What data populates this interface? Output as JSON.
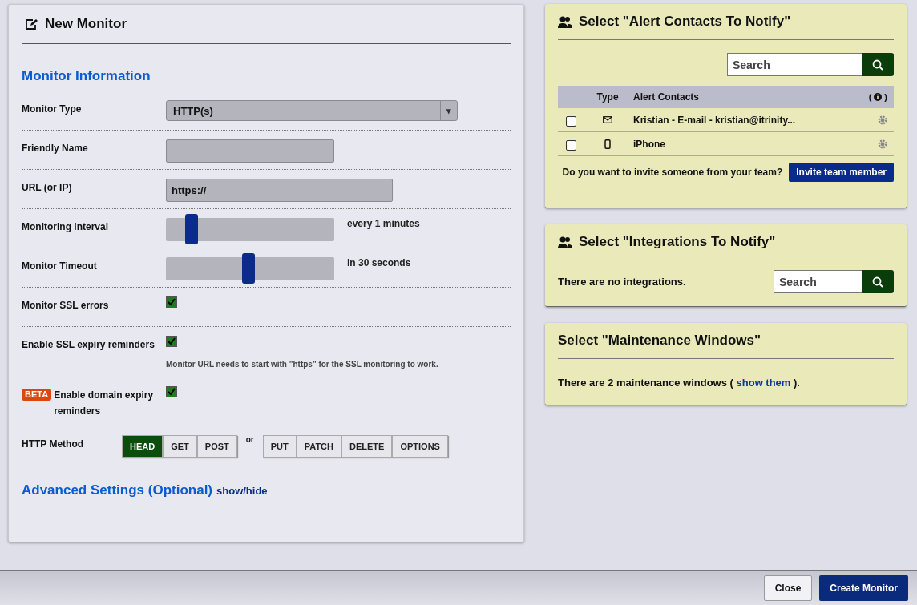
{
  "monitor_panel": {
    "title": "New Monitor",
    "section_title": "Monitor Information",
    "fields": [
      {
        "kind": "select",
        "label": "Monitor Type",
        "value": "HTTP(s)",
        "arrow": "▾"
      },
      {
        "kind": "text",
        "label": "Friendly Name"
      },
      {
        "kind": "url",
        "label": "URL (or IP)",
        "value": "https://"
      },
      {
        "kind": "slider",
        "label": "Monitoring Interval",
        "level": 0.15,
        "reading": "every 1 minutes"
      },
      {
        "kind": "slider",
        "label": "Monitor Timeout",
        "level": 0.49,
        "reading": "in 30 seconds"
      },
      {
        "kind": "checkbox",
        "label": "Monitor SSL errors",
        "checked": true
      },
      {
        "kind": "checkbox",
        "label": "Enable SSL expiry reminders",
        "checked": true,
        "note": "Monitor URL needs to start with \"https\" for the SSL monitoring to work."
      },
      {
        "kind": "checkbox",
        "label": "Enable domain expiry reminders",
        "badge": "BETA",
        "checked": true
      },
      {
        "kind": "methods",
        "label": "HTTP Method",
        "separator": "or",
        "groups": [
          {
            "methods": [
              {
                "label": "HEAD",
                "selected": true
              },
              {
                "label": "GET",
                "selected": false
              },
              {
                "label": "POST",
                "selected": false
              }
            ]
          },
          {
            "methods": [
              {
                "label": "PUT",
                "selected": false
              },
              {
                "label": "PATCH",
                "selected": false
              },
              {
                "label": "DELETE",
                "selected": false
              },
              {
                "label": "OPTIONS",
                "selected": false
              }
            ]
          }
        ]
      }
    ],
    "advanced": {
      "title": "Advanced Settings (Optional)",
      "toggle": "show/hide"
    }
  },
  "alert_contacts": {
    "title": "Select \"Alert Contacts To Notify\"",
    "search": {
      "placeholder": "Search"
    },
    "columns": [
      "Type",
      "Alert Contacts"
    ],
    "info_open": "(",
    "info_close": ")",
    "rows": [
      {
        "kind": "email",
        "name": "Kristian - E-mail - kristian@itrinity...",
        "checked": false
      },
      {
        "kind": "phone",
        "name": "iPhone",
        "checked": false
      }
    ],
    "invite_text": "Do you want to invite someone from your team?",
    "invite_button": "Invite team member"
  },
  "integrations": {
    "title": "Select \"Integrations To Notify\"",
    "message": "There are no integrations.",
    "search": {
      "placeholder": "Search"
    }
  },
  "maintenance": {
    "title": "Select \"Maintenance Windows\"",
    "text_before": "There are 2 maintenance windows ( ",
    "link": "show them",
    "text_after": " )."
  },
  "footer": {
    "buttons": [
      {
        "label": "Close",
        "kind": "secondary"
      },
      {
        "label": "Create Monitor",
        "kind": "primary"
      }
    ]
  }
}
